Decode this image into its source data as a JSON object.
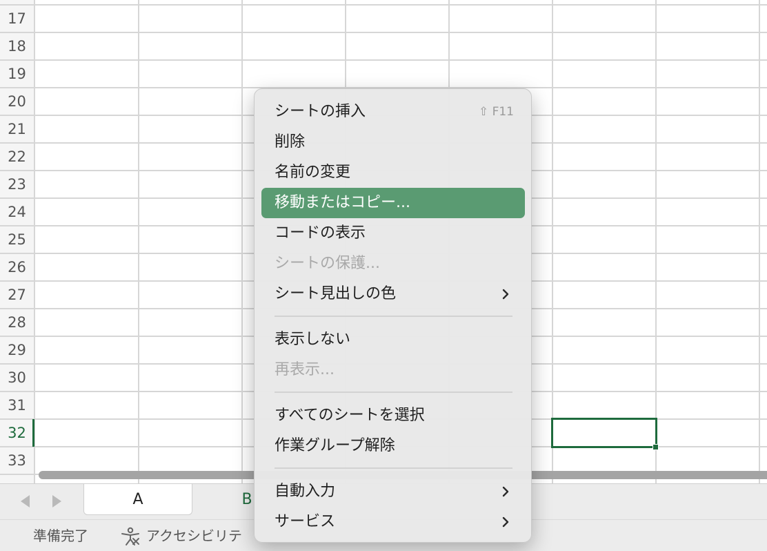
{
  "grid": {
    "row_numbers": [
      "17",
      "18",
      "19",
      "20",
      "21",
      "22",
      "23",
      "24",
      "25",
      "26",
      "27",
      "28",
      "29",
      "30",
      "31",
      "32",
      "33"
    ],
    "active_row": "32"
  },
  "sheet_tabs": {
    "tabs": [
      {
        "label": "A"
      },
      {
        "label": "B"
      }
    ]
  },
  "status_bar": {
    "ready": "準備完了",
    "accessibility": "アクセシビリテ"
  },
  "context_menu": {
    "items": [
      {
        "label": "シートの挿入",
        "shortcut": "⇧ F11"
      },
      {
        "label": "削除"
      },
      {
        "label": "名前の変更"
      },
      {
        "label": "移動またはコピー..."
      },
      {
        "label": "コードの表示"
      },
      {
        "label": "シートの保護..."
      },
      {
        "label": "シート見出しの色"
      },
      {
        "label": "表示しない"
      },
      {
        "label": "再表示..."
      },
      {
        "label": "すべてのシートを選択"
      },
      {
        "label": "作業グループ解除"
      },
      {
        "label": "自動入力"
      },
      {
        "label": "サービス"
      }
    ],
    "highlighted_item": "移動またはコピー...",
    "disabled_items": [
      "シートの保護...",
      "再表示..."
    ]
  },
  "colors": {
    "accent_green": "#1e6b3d",
    "menu_highlight": "#5a9b72"
  }
}
